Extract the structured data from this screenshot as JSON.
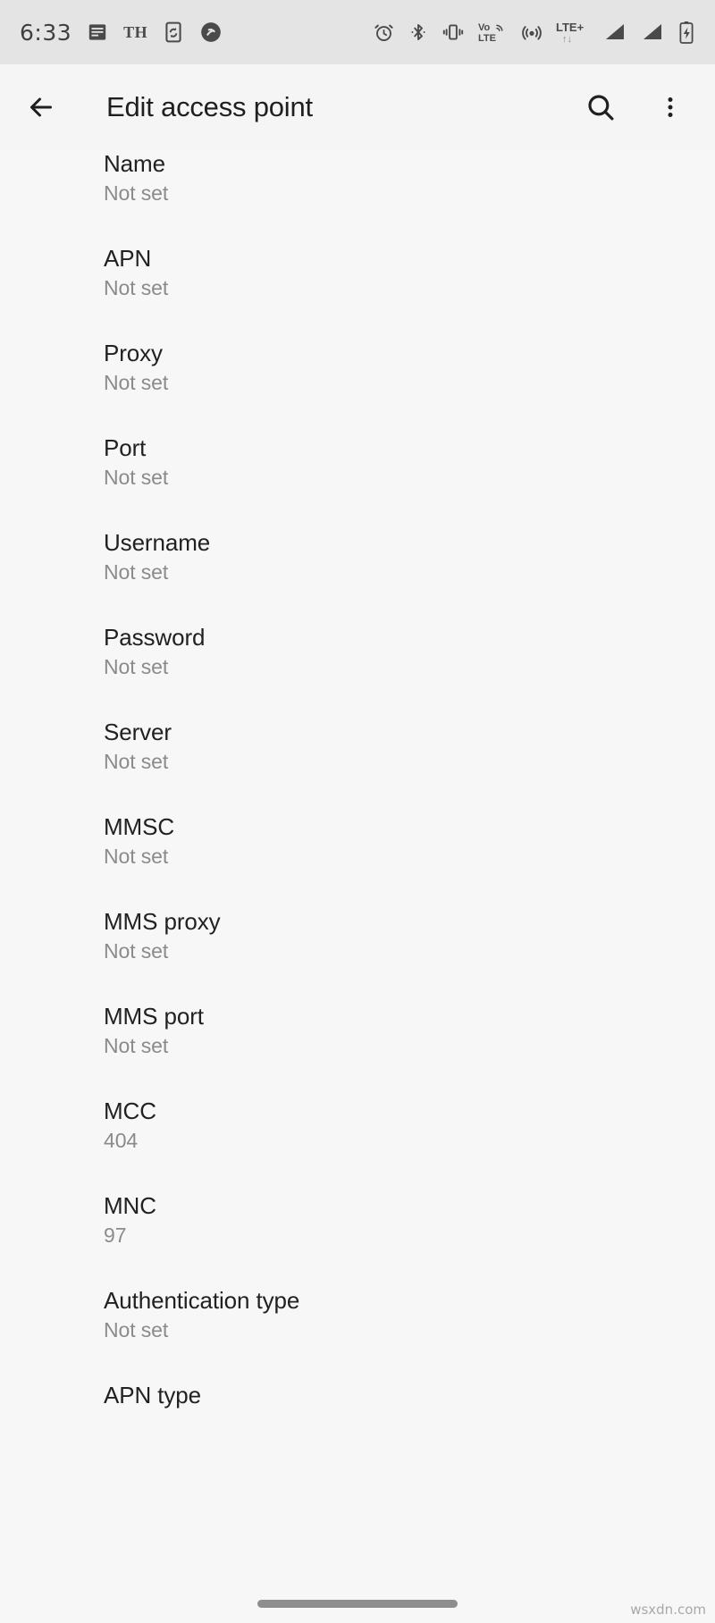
{
  "status_bar": {
    "clock": "6:33",
    "left_icons": [
      {
        "name": "notification-list-icon",
        "glyph": "list"
      },
      {
        "name": "th-text-indicator",
        "glyph": "TH"
      },
      {
        "name": "phone-sync-icon",
        "glyph": "sync"
      },
      {
        "name": "shazam-icon",
        "glyph": "shazam"
      }
    ],
    "right_icons": [
      {
        "name": "alarm-icon"
      },
      {
        "name": "bluetooth-icon"
      },
      {
        "name": "vibrate-icon"
      },
      {
        "name": "volte-icon",
        "label": "VoLTE"
      },
      {
        "name": "hotspot-icon"
      },
      {
        "name": "lte-plus-icon",
        "label": "LTE+"
      },
      {
        "name": "signal-bars-sim1-icon"
      },
      {
        "name": "signal-bars-sim2-icon"
      },
      {
        "name": "battery-charging-icon"
      }
    ]
  },
  "app_bar": {
    "title": "Edit access point",
    "back_label": "Back",
    "search_label": "Search",
    "overflow_label": "More options"
  },
  "preferences": [
    {
      "title": "Name",
      "summary": "Not set"
    },
    {
      "title": "APN",
      "summary": "Not set"
    },
    {
      "title": "Proxy",
      "summary": "Not set"
    },
    {
      "title": "Port",
      "summary": "Not set"
    },
    {
      "title": "Username",
      "summary": "Not set"
    },
    {
      "title": "Password",
      "summary": "Not set"
    },
    {
      "title": "Server",
      "summary": "Not set"
    },
    {
      "title": "MMSC",
      "summary": "Not set"
    },
    {
      "title": "MMS proxy",
      "summary": "Not set"
    },
    {
      "title": "MMS port",
      "summary": "Not set"
    },
    {
      "title": "MCC",
      "summary": "404"
    },
    {
      "title": "MNC",
      "summary": "97"
    },
    {
      "title": "Authentication type",
      "summary": "Not set"
    },
    {
      "title": "APN type",
      "summary": ""
    }
  ],
  "watermark": "wsxdn.com",
  "colors": {
    "status_bar_bg": "#e4e4e4",
    "app_bar_bg": "#f5f5f5",
    "content_bg": "#f7f7f7",
    "title_text": "#212121",
    "summary_text": "#8b8b8b",
    "nav_pill": "#8e8e8e"
  }
}
